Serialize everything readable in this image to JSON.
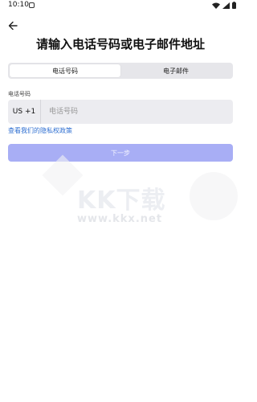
{
  "status_bar": {
    "time": "10:10"
  },
  "header": {
    "title": "请输入电话号码或电子邮件地址"
  },
  "tabs": [
    {
      "label": "电话号码",
      "active": true
    },
    {
      "label": "电子邮件",
      "active": false
    }
  ],
  "phone_field": {
    "label": "电话号码",
    "country_code": "US +1",
    "placeholder": "电话号码",
    "value": ""
  },
  "privacy_link": "查看我们的隐私权政策",
  "next_button": {
    "label": "下一步",
    "enabled": false
  },
  "watermark": {
    "logo": "KK下载",
    "url": "www.kkx.net"
  },
  "colors": {
    "accent_disabled": "#a8aef5",
    "link": "#2f6fd1",
    "segment_bg": "#e6e6ea",
    "input_bg": "#ececf0"
  }
}
